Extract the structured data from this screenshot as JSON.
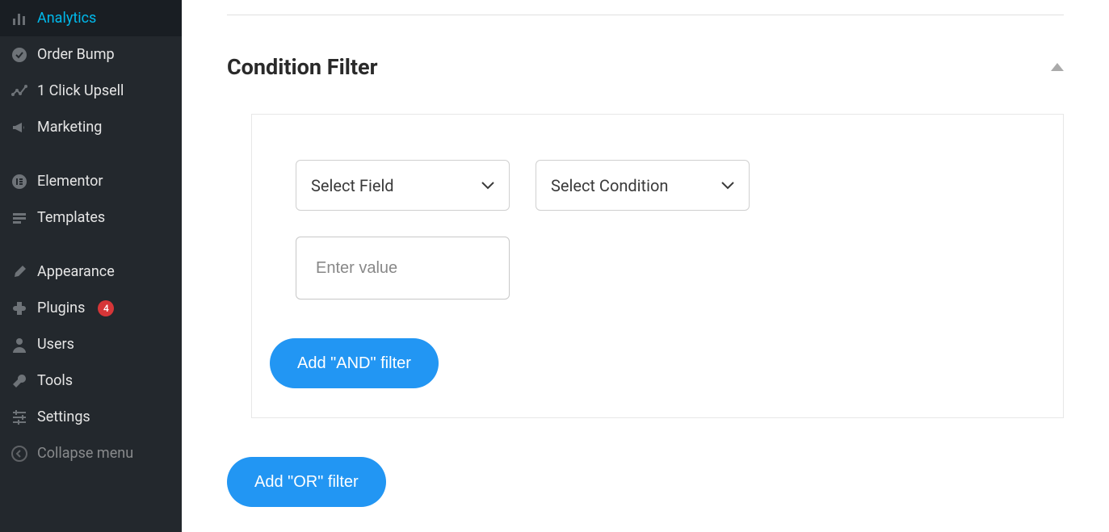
{
  "sidebar": {
    "items": [
      {
        "label": "Analytics",
        "icon": "analytics-icon"
      },
      {
        "label": "Order Bump",
        "icon": "check-circle-icon"
      },
      {
        "label": "1 Click Upsell",
        "icon": "chart-up-icon"
      },
      {
        "label": "Marketing",
        "icon": "megaphone-icon"
      }
    ],
    "items2": [
      {
        "label": "Elementor",
        "icon": "elementor-icon"
      },
      {
        "label": "Templates",
        "icon": "templates-icon"
      }
    ],
    "items3": [
      {
        "label": "Appearance",
        "icon": "brush-icon"
      },
      {
        "label": "Plugins",
        "icon": "plugin-icon",
        "badge": "4"
      },
      {
        "label": "Users",
        "icon": "user-icon"
      },
      {
        "label": "Tools",
        "icon": "wrench-icon"
      },
      {
        "label": "Settings",
        "icon": "sliders-icon"
      }
    ],
    "collapse_label": "Collapse menu"
  },
  "section": {
    "title": "Condition Filter"
  },
  "filter": {
    "select_field_label": "Select Field",
    "select_condition_label": "Select Condition",
    "value_placeholder": "Enter value",
    "add_and_label": "Add \"AND\" filter",
    "add_or_label": "Add \"OR\" filter"
  }
}
